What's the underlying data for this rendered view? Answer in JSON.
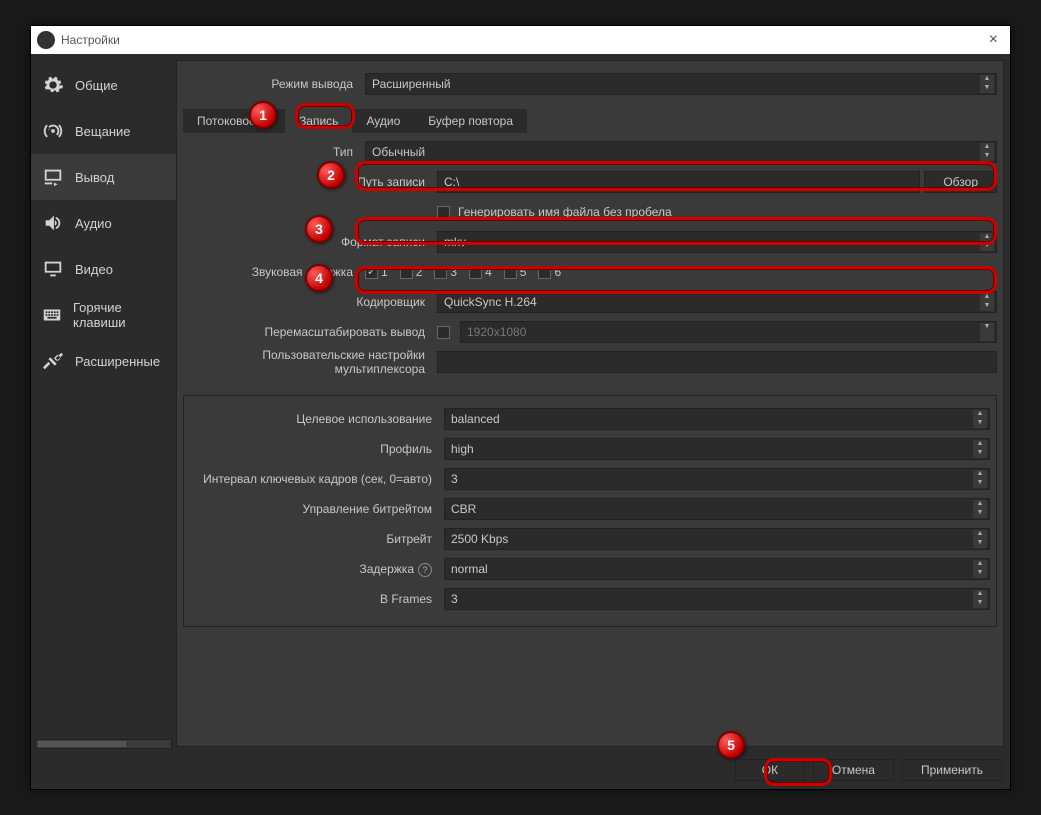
{
  "window": {
    "title": "Настройки"
  },
  "sidebar": {
    "items": [
      {
        "label": "Общие"
      },
      {
        "label": "Вещание"
      },
      {
        "label": "Вывод"
      },
      {
        "label": "Аудио"
      },
      {
        "label": "Видео"
      },
      {
        "label": "Горячие клавиши"
      },
      {
        "label": "Расширенные"
      }
    ]
  },
  "output_mode": {
    "label": "Режим вывода",
    "value": "Расширенный"
  },
  "tabs": {
    "items": [
      "Потоковое …",
      "Запись",
      "Аудио",
      "Буфер повтора"
    ],
    "active": 1
  },
  "recording": {
    "type_label": "Тип",
    "type_value": "Обычный",
    "path_label": "Путь записи",
    "path_value": "C:\\",
    "browse": "Обзор",
    "nospace_label": "Генерировать имя файла без пробела",
    "format_label": "Формат записи",
    "format_value": "mkv",
    "track_label": "Звуковая дорожка",
    "tracks": [
      "1",
      "2",
      "3",
      "4",
      "5",
      "6"
    ],
    "encoder_label": "Кодировщик",
    "encoder_value": "QuickSync H.264",
    "rescale_label": "Перемасштабировать вывод",
    "rescale_value": "1920x1080",
    "mux_label": "Пользовательские настройки мультиплексора"
  },
  "encoder": {
    "target_label": "Целевое использование",
    "target_value": "balanced",
    "profile_label": "Профиль",
    "profile_value": "high",
    "keyint_label": "Интервал ключевых кадров (сек, 0=авто)",
    "keyint_value": "3",
    "rate_label": "Управление битрейтом",
    "rate_value": "CBR",
    "bitrate_label": "Битрейт",
    "bitrate_value": "2500 Kbps",
    "latency_label": "Задержка",
    "latency_value": "normal",
    "bframes_label": "B Frames",
    "bframes_value": "3"
  },
  "buttons": {
    "ok": "ОК",
    "cancel": "Отмена",
    "apply": "Применить"
  },
  "badges": [
    "1",
    "2",
    "3",
    "4",
    "5"
  ]
}
